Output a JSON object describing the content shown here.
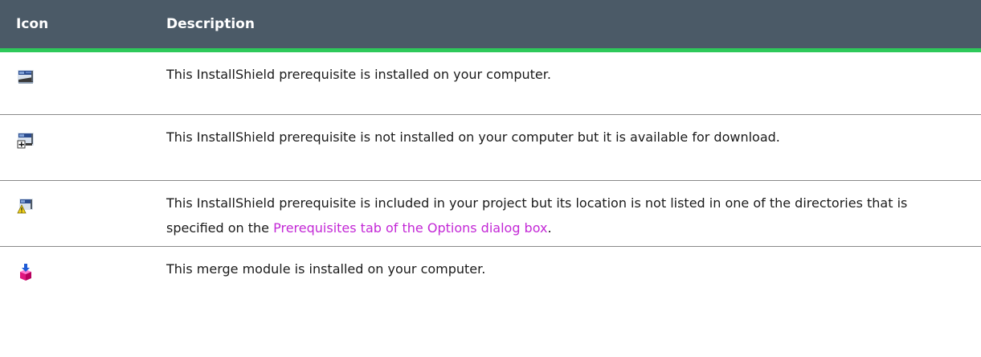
{
  "table": {
    "headers": {
      "icon": "Icon",
      "description": "Description"
    },
    "rows": [
      {
        "icon": "installed-prerequisite-icon",
        "description": "This InstallShield prerequisite is installed on your computer."
      },
      {
        "icon": "downloadable-prerequisite-icon",
        "description": "This InstallShield prerequisite is not installed on your computer but it is available for download."
      },
      {
        "icon": "missing-location-prerequisite-icon",
        "description_before": "This InstallShield prerequisite is included in your project but its location is not listed in one of the directories that is specified on the ",
        "link_text": "Prerequisites tab of the Options dialog box",
        "description_after": "."
      },
      {
        "icon": "merge-module-installed-icon",
        "description": "This merge module is installed on your computer."
      }
    ]
  },
  "colors": {
    "header_bg": "#4b5a67",
    "header_accent": "#2ec95a",
    "link": "#c328d6"
  }
}
